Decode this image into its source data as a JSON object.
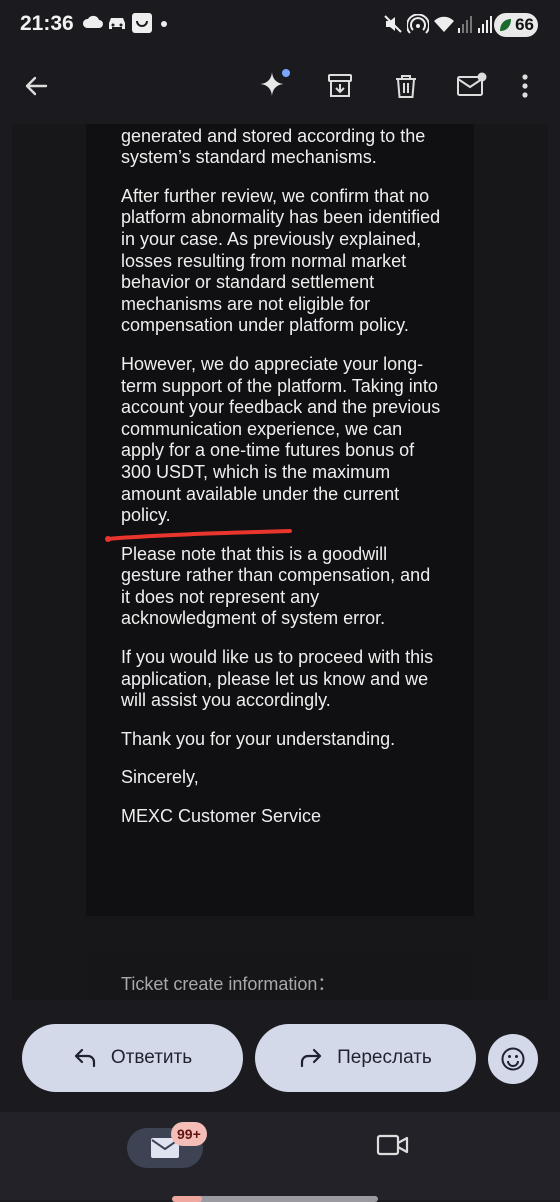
{
  "status_bar": {
    "time": "21:36",
    "battery": "66"
  },
  "email": {
    "paragraphs": [
      "trading records, and all data is generated and stored according to the system’s standard mechanisms.",
      "After further review, we confirm that no platform abnormality has been identified in your case. As previously explained, losses resulting from normal market behavior or standard settlement mechanisms are not eligible for compensation under platform policy.",
      "However, we do appreciate your long-term support of the platform. Taking into account your feedback and the previous communication experience, we can apply for a one-time futures bonus of 300 USDT, which is the maximum amount available under the current policy.",
      "Please note that this is a goodwill gesture rather than compensation, and it does not represent any acknowledgment of system error.",
      "If you would like us to proceed with this application, please let us know and we will assist you accordingly.",
      "Thank you for your understanding.",
      "Sincerely,",
      "MEXC Customer Service"
    ],
    "ticket_info": "Ticket create information："
  },
  "actions": {
    "reply_label": "Ответить",
    "forward_label": "Переслать"
  },
  "bottom_nav": {
    "mail_badge": "99+"
  },
  "colors": {
    "pill_bg": "#d4d9e9",
    "annotation_red": "#e8352d",
    "badge_bg": "#f4bdb7"
  }
}
